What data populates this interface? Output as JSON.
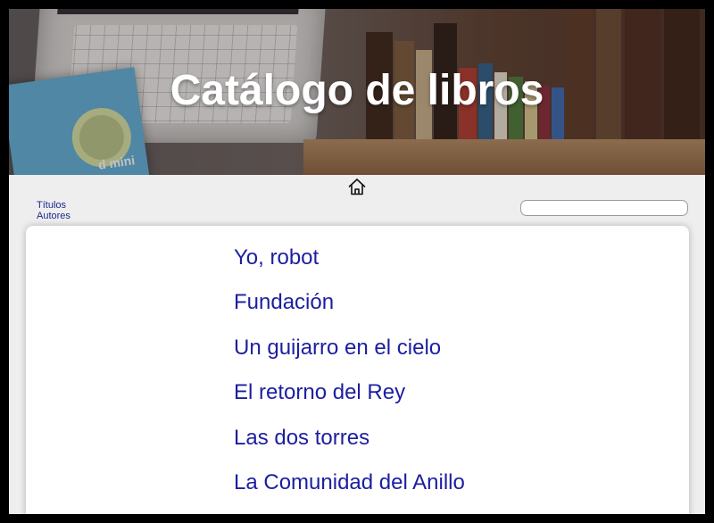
{
  "header": {
    "title": "Catálogo de libros",
    "device_label": "d mini"
  },
  "nav": {
    "home_icon": "home-icon",
    "links": [
      {
        "label": "Títulos"
      },
      {
        "label": "Autores"
      }
    ],
    "search": {
      "value": "",
      "placeholder": ""
    }
  },
  "books": [
    {
      "title": "Yo, robot"
    },
    {
      "title": "Fundación"
    },
    {
      "title": "Un guijarro en el cielo"
    },
    {
      "title": "El retorno del Rey"
    },
    {
      "title": "Las dos torres"
    },
    {
      "title": "La Comunidad del Anillo"
    }
  ],
  "colors": {
    "link": "#1c1ea0",
    "nav_link": "#1a2a8c",
    "title_text": "#ffffff",
    "page_background": "#efeeee",
    "frame": "#000000"
  }
}
